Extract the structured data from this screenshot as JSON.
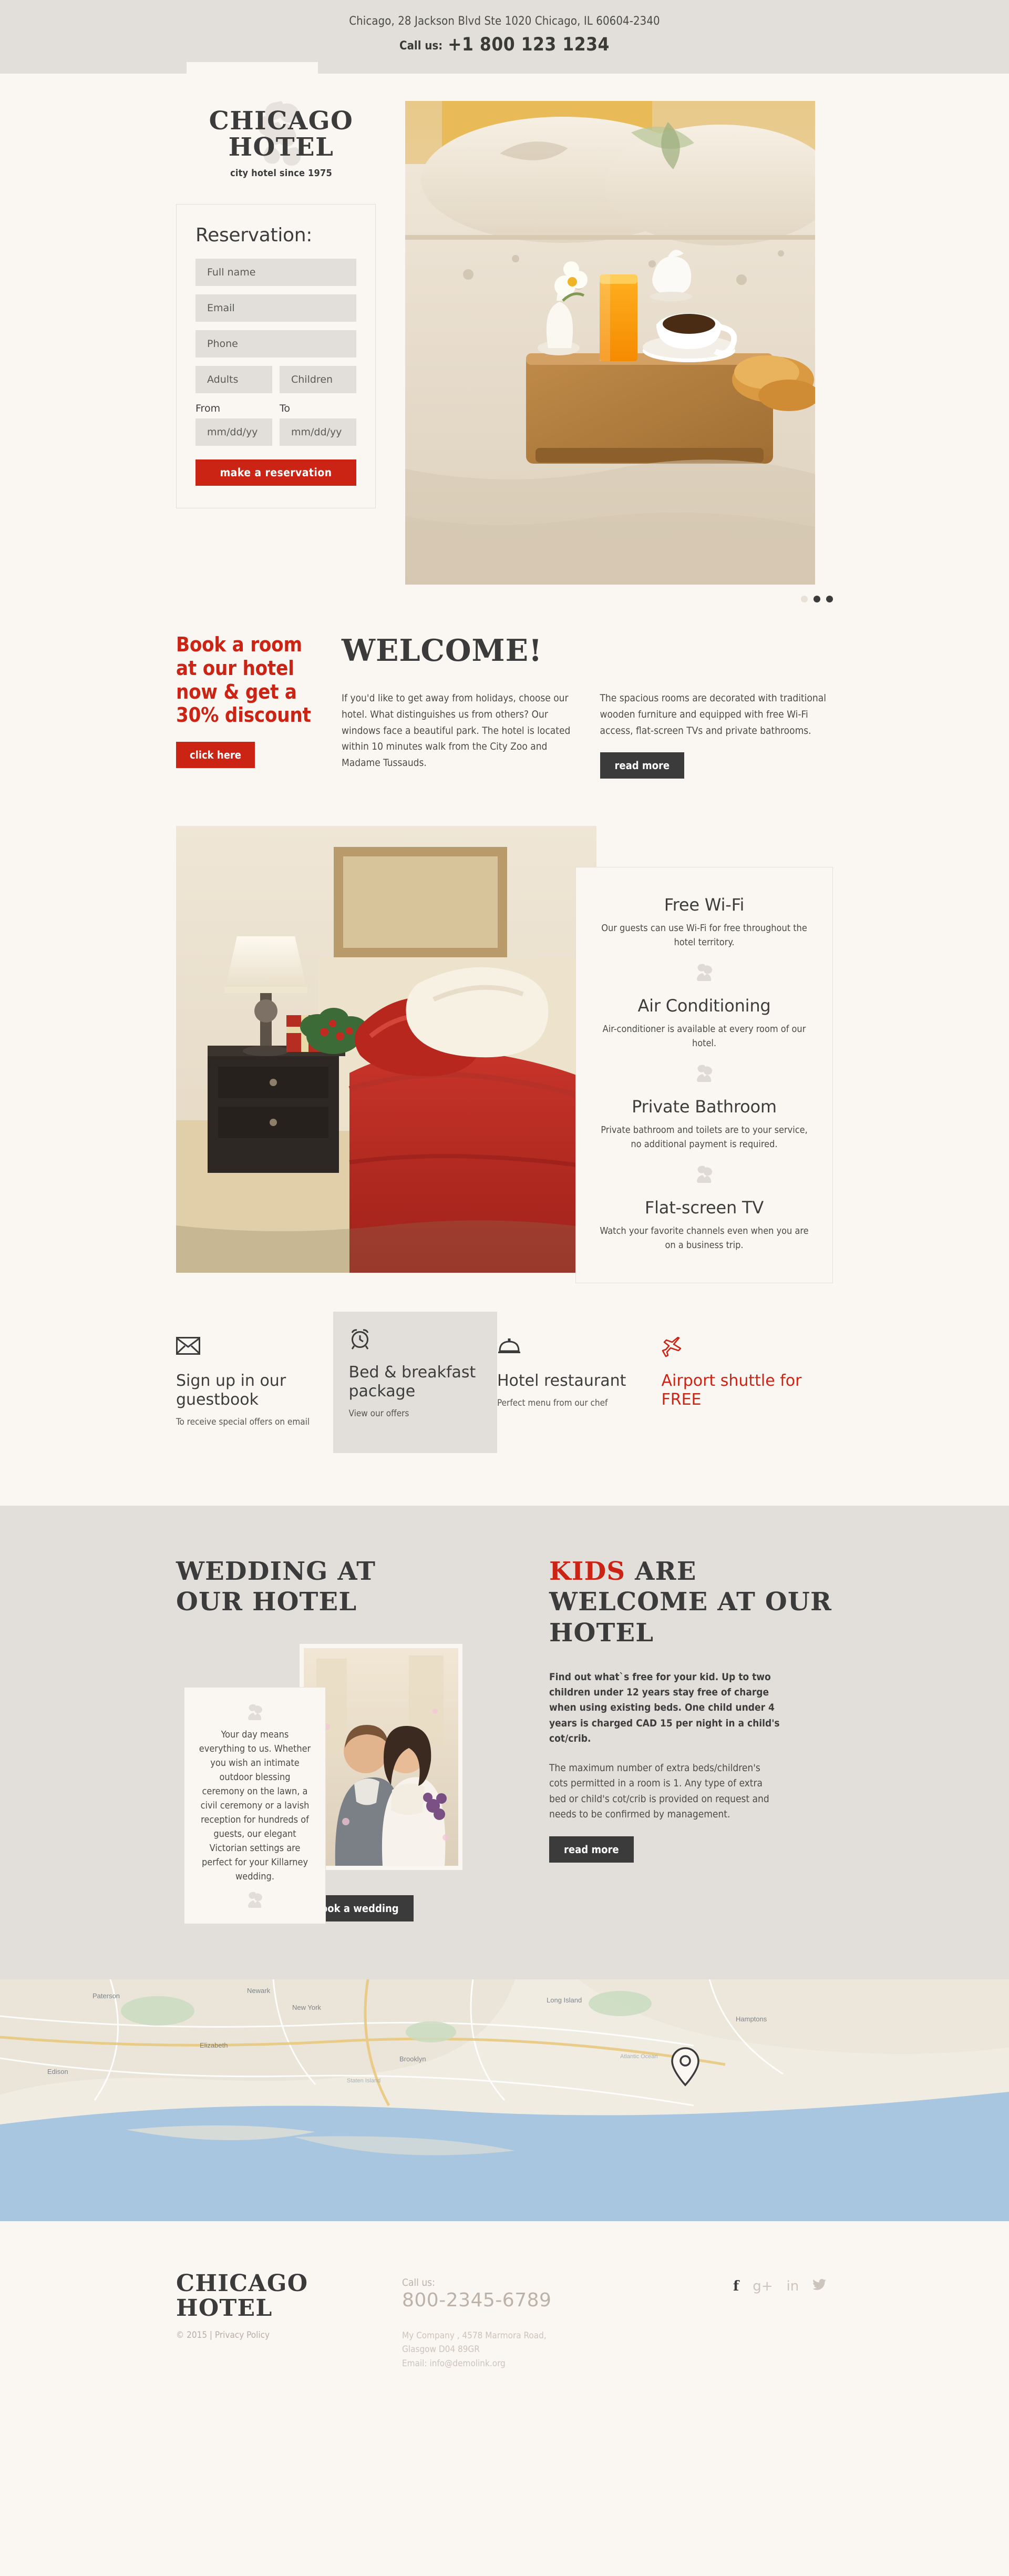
{
  "topbar": {
    "address": "Chicago, 28 Jackson Blvd Ste 1020 Chicago, IL 60604-2340",
    "call_label": "Call us:",
    "phone": "+1 800 123 1234"
  },
  "logo": {
    "line1": "Chicago",
    "line2": "Hotel",
    "tagline": "city hotel since 1975"
  },
  "reservation": {
    "heading": "Reservation:",
    "fullname_placeholder": "Full name",
    "email_placeholder": "Email",
    "phone_placeholder": "Phone",
    "adults_placeholder": "Adults",
    "children_placeholder": "Children",
    "from_label": "From",
    "to_label": "To",
    "date_from_placeholder": "mm/dd/yy",
    "date_to_placeholder": "mm/dd/yy",
    "submit_label": "make a reservation"
  },
  "slider": {
    "dots": 3,
    "active_index": 0
  },
  "promo": {
    "title": "Book a room at our hotel now & get a 30% discount",
    "button_label": "click here"
  },
  "welcome": {
    "heading": "Welcome!",
    "col1": "If you'd like to get away from holidays, choose our hotel. What distinguishes us from others? Our windows face a beautiful park. The hotel is located within 10 minutes walk from the City Zoo and Madame Tussauds.",
    "col2": "The spacious rooms are decorated with traditional wooden furniture and equipped with free Wi-Fi access, flat-screen TVs and private bathrooms.",
    "read_more_label": "read more"
  },
  "features": [
    {
      "title": "Free Wi-Fi",
      "desc": "Our guests can use Wi-Fi for free throughout the hotel territory."
    },
    {
      "title": "Air Conditioning",
      "desc": "Air-conditioner is available at every room of our hotel."
    },
    {
      "title": "Private Bathroom",
      "desc": "Private bathroom and toilets are to your service, no additional payment is required."
    },
    {
      "title": "Flat-screen TV",
      "desc": "Watch your favorite channels even when you are on a business trip."
    }
  ],
  "services": [
    {
      "icon": "envelope-icon",
      "title": "Sign up in our guestbook",
      "desc": "To receive special offers on email",
      "highlight": false,
      "red": false
    },
    {
      "icon": "alarm-clock-icon",
      "title": "Bed & breakfast package",
      "desc": "View our offers",
      "highlight": true,
      "red": false
    },
    {
      "icon": "service-bell-icon",
      "title": "Hotel restaurant",
      "desc": "Perfect menu from our chef",
      "highlight": false,
      "red": false
    },
    {
      "icon": "airplane-icon",
      "title": "Airport shuttle for FREE",
      "desc": "",
      "highlight": false,
      "red": true
    }
  ],
  "wedding": {
    "heading_line1": "Wedding at",
    "heading_line2": "our hotel",
    "quote": "Your day means everything to us. Whether you wish an intimate outdoor blessing ceremony on the lawn, a civil ceremony or a lavish reception for hundreds of guests, our elegant Victorian settings are perfect for your Killarney wedding.",
    "button_label": "book a wedding"
  },
  "kids": {
    "heading_red": "Kids",
    "heading_rest": " are Welcome at our Hotel",
    "paragraph_bold": "Find out what`s free for your kid. Up to two children under 12 years stay free of charge when using existing beds. One child under 4 years is charged CAD 15 per night in a child's cot/crib.",
    "paragraph_regular": "The maximum number of extra beds/children's cots permitted in a room is 1. Any type of extra bed or child's cot/crib is provided on request and needs to be confirmed by management.",
    "read_more_label": "read more"
  },
  "footer": {
    "logo_line1": "Chicago",
    "logo_line2": "Hotel",
    "copyright": "© 2015 | Privacy Policy",
    "call_label": "Call us:",
    "phone": "800-2345-6789",
    "address_line1": "My Company , 4578 Marmora Road,",
    "address_line2": "Glasgow D04 89GR",
    "address_line3": "Email: info@demolink.org",
    "social": [
      {
        "name": "facebook-icon",
        "glyph": "f"
      },
      {
        "name": "google-plus-icon",
        "glyph": "g+"
      },
      {
        "name": "linkedin-icon",
        "glyph": "in"
      },
      {
        "name": "twitter-icon",
        "glyph": "ᵗ"
      }
    ]
  },
  "colors": {
    "accent_red": "#cb2414",
    "dark": "#3b3b3b",
    "page_bg": "#faf6f2",
    "panel_bg": "#e2ded9"
  }
}
